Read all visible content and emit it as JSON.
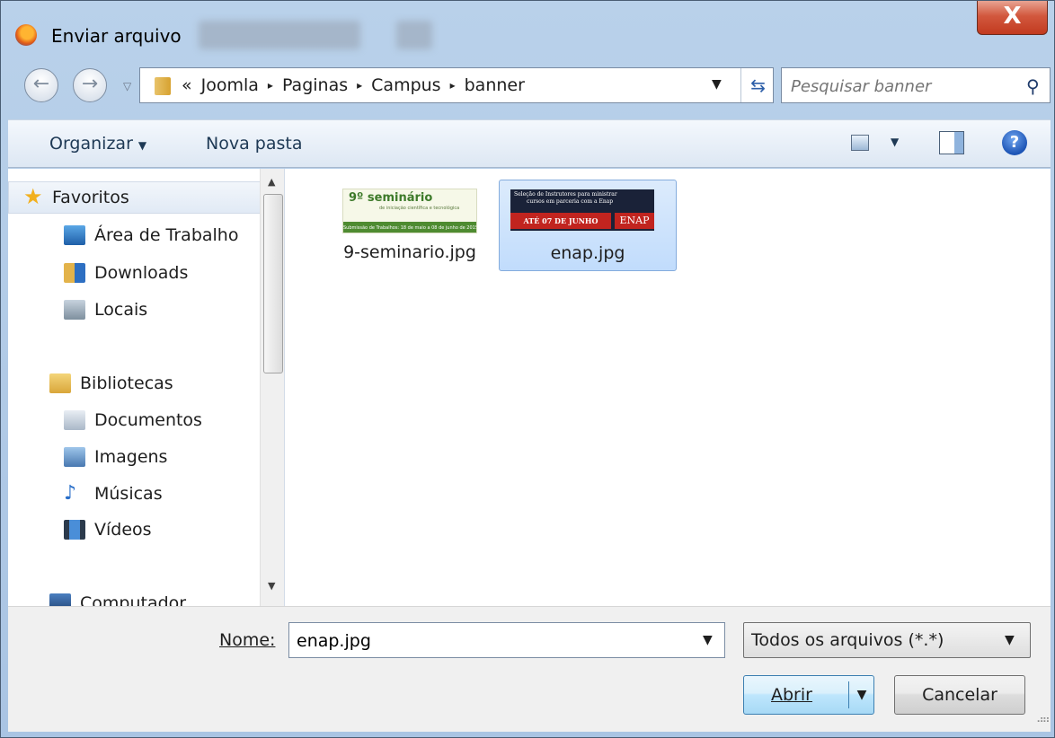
{
  "window": {
    "title": "Enviar arquivo",
    "close_label": "X"
  },
  "nav": {
    "breadcrumb_prefix": "«",
    "breadcrumbs": [
      "Joomla",
      "Paginas",
      "Campus",
      "banner"
    ],
    "separator": "▸",
    "search_placeholder": "Pesquisar banner"
  },
  "toolbar": {
    "organize_label": "Organizar",
    "new_folder_label": "Nova pasta"
  },
  "sidebar": {
    "groups": [
      {
        "label": "Favoritos",
        "items": [
          "Área de Trabalho",
          "Downloads",
          "Locais"
        ]
      },
      {
        "label": "Bibliotecas",
        "items": [
          "Documentos",
          "Imagens",
          "Músicas",
          "Vídeos"
        ]
      },
      {
        "label": "Computador",
        "items": []
      }
    ]
  },
  "files": [
    {
      "name": "9-seminario.jpg",
      "selected": false,
      "thumb_lines": [
        "9º seminário",
        "de iniciação científica e tecnológica",
        "Submissão de Trabalhos: 18 de maio a 08 de junho de 2015"
      ]
    },
    {
      "name": "enap.jpg",
      "selected": true,
      "thumb_lines": [
        "Seleção de Instrutores para ministrar",
        "cursos em parceria com a Enap",
        "ATÉ 07 DE JUNHO",
        "ENAP"
      ]
    }
  ],
  "bottom": {
    "name_label": "Nome:",
    "name_value": "enap.jpg",
    "filter_value": "Todos os arquivos (*.*)",
    "open_label": "Abrir",
    "cancel_label": "Cancelar"
  },
  "colors": {
    "accent": "#3c7fb1",
    "selection": "#c1dcfc",
    "close": "#c23a1f"
  }
}
